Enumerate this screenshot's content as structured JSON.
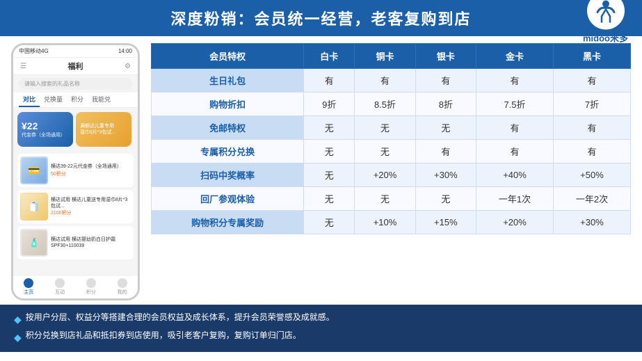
{
  "header": {
    "title": "深度粉销：会员统一经营，老客复购到店",
    "logo_name": "midoo米多"
  },
  "phone": {
    "status_left": "中国移动4G",
    "status_right": "14:00",
    "nav_title": "福利",
    "search_placeholder": "请输入搜索的礼品名称",
    "tabs": [
      "对比",
      "兑换量",
      "积分",
      "我能兑"
    ],
    "active_tab": 0,
    "card1": {
      "price": "¥22",
      "desc": "代金券（全场通用）"
    },
    "card2": {
      "desc": "满额达儿童专用湿巾8片*3包试..."
    },
    "items": [
      {
        "name": "横达39-22元代金券（全场通用）",
        "points": "50积分"
      },
      {
        "name": "横达试用 横达儿童送专用湿巾8片*3包试...",
        "points": "2100积分"
      },
      {
        "name": "横达试用 横达婴幼奶白日护霜 SPF30+110039",
        "points": ""
      }
    ],
    "bottom_nav": [
      "主页",
      "互动",
      "积分",
      "我的"
    ]
  },
  "table": {
    "headers": [
      "会员特权",
      "白卡",
      "铜卡",
      "银卡",
      "金卡",
      "黑卡"
    ],
    "rows": [
      [
        "生日礼包",
        "有",
        "有",
        "有",
        "有",
        "有"
      ],
      [
        "购物折扣",
        "9折",
        "8.5折",
        "8折",
        "7.5折",
        "7折"
      ],
      [
        "免邮特权",
        "无",
        "无",
        "无",
        "有",
        "有"
      ],
      [
        "专属积分兑换",
        "无",
        "无",
        "有",
        "有",
        "有"
      ],
      [
        "扫码中奖概率",
        "无",
        "+20%",
        "+30%",
        "+40%",
        "+50%"
      ],
      [
        "回厂参观体验",
        "无",
        "无",
        "无",
        "一年1次",
        "一年2次"
      ],
      [
        "购物积分专属奖励",
        "无",
        "+10%",
        "+15%",
        "+20%",
        "+30%"
      ]
    ]
  },
  "footer": {
    "items": [
      "按用户分层、权益分等搭建合理的会员权益及成长体系，提升会员荣誉感及成就感。",
      "积分兑换到店礼品和抵扣券到店使用，吸引老客户复购，复购订单归门店。"
    ],
    "bullet": "◆"
  }
}
